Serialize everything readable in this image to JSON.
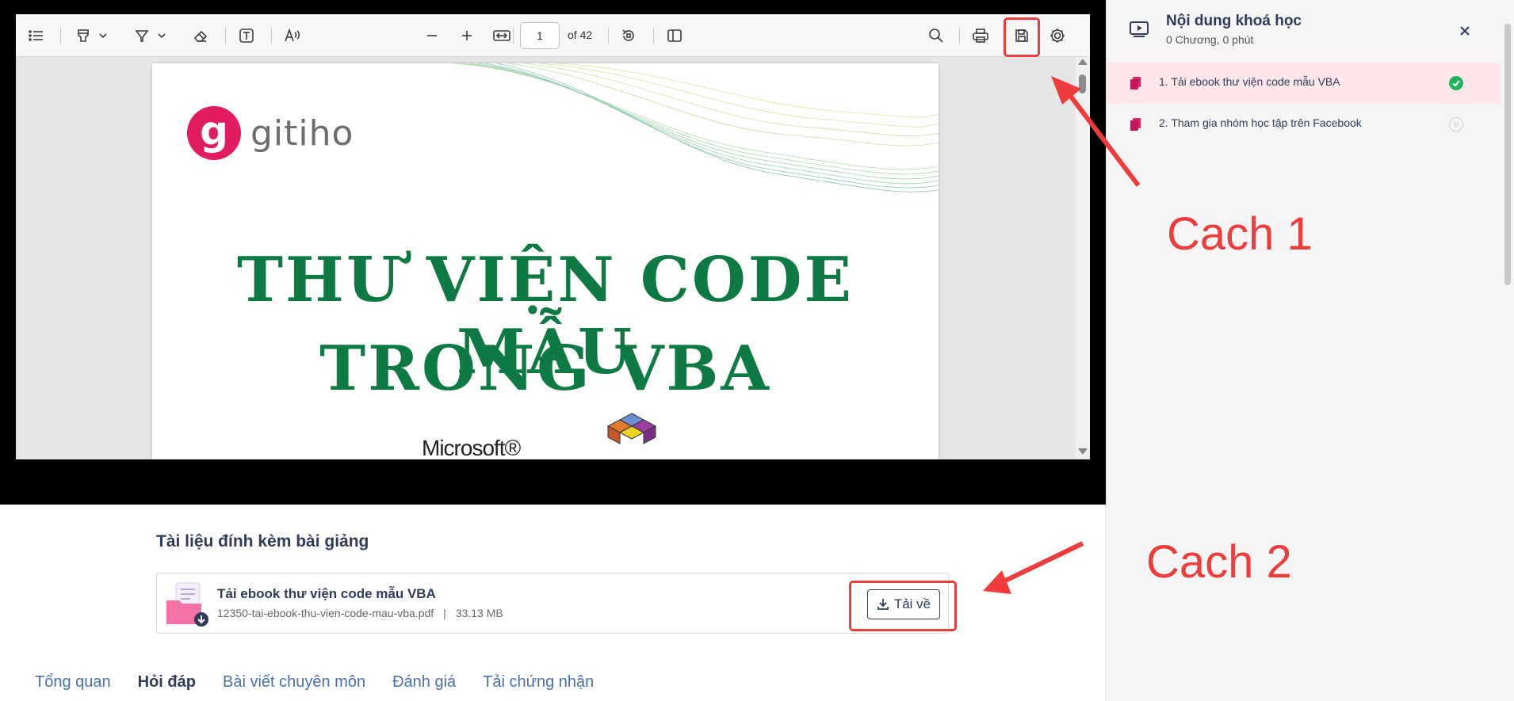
{
  "viewer": {
    "page_current": "1",
    "page_total_label": "of 42",
    "document": {
      "brand": "gitiho",
      "brand_letter": "g",
      "title_line1": "THƯ VIỆN CODE MẪU",
      "title_line2": "TRONG VBA",
      "microsoft": "Microsoft®"
    }
  },
  "attachments": {
    "heading": "Tài liệu đính kèm bài giảng",
    "file": {
      "name": "Tải ebook thư viện code mẫu VBA",
      "filename": "12350-tai-ebook-thu-vien-code-mau-vba.pdf",
      "separator": "|",
      "size": "33.13 MB",
      "download_label": "Tải về"
    }
  },
  "tabs": [
    {
      "label": "Tổng quan",
      "active": false
    },
    {
      "label": "Hỏi đáp",
      "active": true
    },
    {
      "label": "Bài viết chuyên môn",
      "active": false
    },
    {
      "label": "Đánh giá",
      "active": false
    },
    {
      "label": "Tải chứng nhận",
      "active": false
    }
  ],
  "sidebar": {
    "title": "Nội dung khoá học",
    "subtitle": "0 Chương, 0 phút",
    "lessons": [
      {
        "label": "1. Tải ebook thư viện code mẫu VBA",
        "status": "done",
        "active": true
      },
      {
        "label": "2. Tham gia nhóm học tập trên Facebook",
        "status": "todo",
        "status_text": "0",
        "active": false
      }
    ]
  },
  "annotations": {
    "note1": "Cach 1",
    "note2": "Cach 2",
    "color": "#ee3b3b"
  },
  "colors": {
    "accent_dark": "#2f3b58",
    "brand_pink": "#e21d5d",
    "title_green": "#0d7a43",
    "done_green": "#22b45c",
    "active_row": "#fde7ea"
  },
  "icons": [
    "toc-icon",
    "highlighter-icon",
    "chevron-down-icon",
    "draw-icon",
    "eraser-icon",
    "text-box-icon",
    "read-aloud-icon",
    "zoom-out-icon",
    "zoom-in-icon",
    "fit-width-icon",
    "rotate-icon",
    "page-view-icon",
    "search-icon",
    "print-icon",
    "save-icon",
    "settings-icon",
    "course-video-icon",
    "close-icon",
    "document-icon",
    "check-icon",
    "download-icon"
  ]
}
